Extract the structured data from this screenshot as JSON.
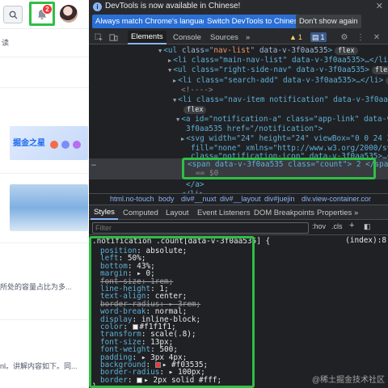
{
  "site": {
    "notification_count": "2",
    "text_lines": [
      "读",
      "所处的容量占比为多...",
      "nl。讲解内容如下。同..."
    ]
  },
  "infobar": {
    "message": "DevTools is now available in Chinese!",
    "btn_match": "Always match Chrome's language",
    "btn_switch": "Switch DevTools to Chinese",
    "btn_dismiss": "Don't show again",
    "close": "✕"
  },
  "toolbar": {
    "tabs": [
      "Elements",
      "Console",
      "Sources"
    ],
    "more": "»",
    "warnings": "1",
    "messages": "1"
  },
  "dom": {
    "l1": {
      "tag": "ul",
      "attr": "class",
      "val": "nav-list",
      "data": "data-v-3f0aa535",
      "pill": "flex"
    },
    "l2": {
      "text": "<li class=\"main-nav-list\" data-v-3f0aa535>…</li>"
    },
    "l3": {
      "text": "<ul class=\"right-side-nav\" data-v-3f0aa535>",
      "pill": "flex"
    },
    "l4": {
      "text": "<li class=\"search-add\" data-v-3f0aa535>…</li>",
      "pill": "flex"
    },
    "l5": {
      "text": "<!---->"
    },
    "l6": {
      "text": "<li class=\"nav-item notification\" data-v-3f0aa535>",
      "pill": "flex"
    },
    "l7a": {
      "text": "<a id=\"notification-a\" class=\"app-link\" data-v-"
    },
    "l7b": {
      "text": "3f0aa535 href=\"/notification\">"
    },
    "l8a": {
      "text": "<svg width=\"24\" height=\"24\" viewBox=\"0 0 24 24\""
    },
    "l8b": {
      "text": "fill=\"none\" xmlns=\"http://www.w3.org/2000/svg\""
    },
    "l8c": {
      "text": "class=\"notification-icon\" data-v-3f0aa535>…</svg>"
    },
    "l9a": {
      "text": "<span data-v-3f0aa535 class=\"count\"> 2 </span>"
    },
    "l9b": {
      "text": "== $0"
    },
    "l10": {
      "text": "</a>"
    },
    "l11": {
      "text": "</li>"
    }
  },
  "crumbs": [
    "html.no-touch",
    "body",
    "div#__nuxt",
    "div#__layout",
    "div#juejin",
    "div.view-container.cor"
  ],
  "styletabs": [
    "Styles",
    "Computed",
    "Layout",
    "Event Listeners",
    "DOM Breakpoints",
    "Properties",
    "»"
  ],
  "filter": {
    "placeholder": "Filter",
    "hov": ":hov",
    "cls": ".cls",
    "plus": "+"
  },
  "rule": {
    "selector": ".notification .count[data-v-3f0aa535] {",
    "source": "(index):8",
    "props": [
      {
        "n": "position",
        "v": "absolute;"
      },
      {
        "n": "left",
        "v": "50%;"
      },
      {
        "n": "bottom",
        "v": "43%;"
      },
      {
        "n": "margin",
        "v": "▸ 0;"
      },
      {
        "n": "font-size",
        "v": "1rem;",
        "strike": true
      },
      {
        "n": "line-height",
        "v": "1;"
      },
      {
        "n": "text-align",
        "v": "center;"
      },
      {
        "n": "border-radius",
        "v": "▸ 3rem;",
        "strike": true
      },
      {
        "n": "word-break",
        "v": "normal;"
      },
      {
        "n": "display",
        "v": "inline-block;"
      },
      {
        "n": "color",
        "v": "#f1f1f1;",
        "swatch": "#f1f1f1"
      },
      {
        "n": "transform",
        "v": "scale(.8);"
      },
      {
        "n": "font-size",
        "v": "13px;"
      },
      {
        "n": "font-weight",
        "v": "500;"
      },
      {
        "n": "padding",
        "v": "▸ 3px 4px;"
      },
      {
        "n": "background",
        "v": "▸ #f03535;",
        "swatch": "#f03535"
      },
      {
        "n": "border-radius",
        "v": "▸ 100px;"
      },
      {
        "n": "border",
        "v": "▸ 2px solid #fff;",
        "swatch": "#ffffff"
      }
    ],
    "close": "}"
  },
  "watermark": "@稀土掘金技术社区",
  "colors": {
    "badge": "#f03535",
    "highlight": "#2fbf44",
    "accent": "#8ab4f8"
  }
}
